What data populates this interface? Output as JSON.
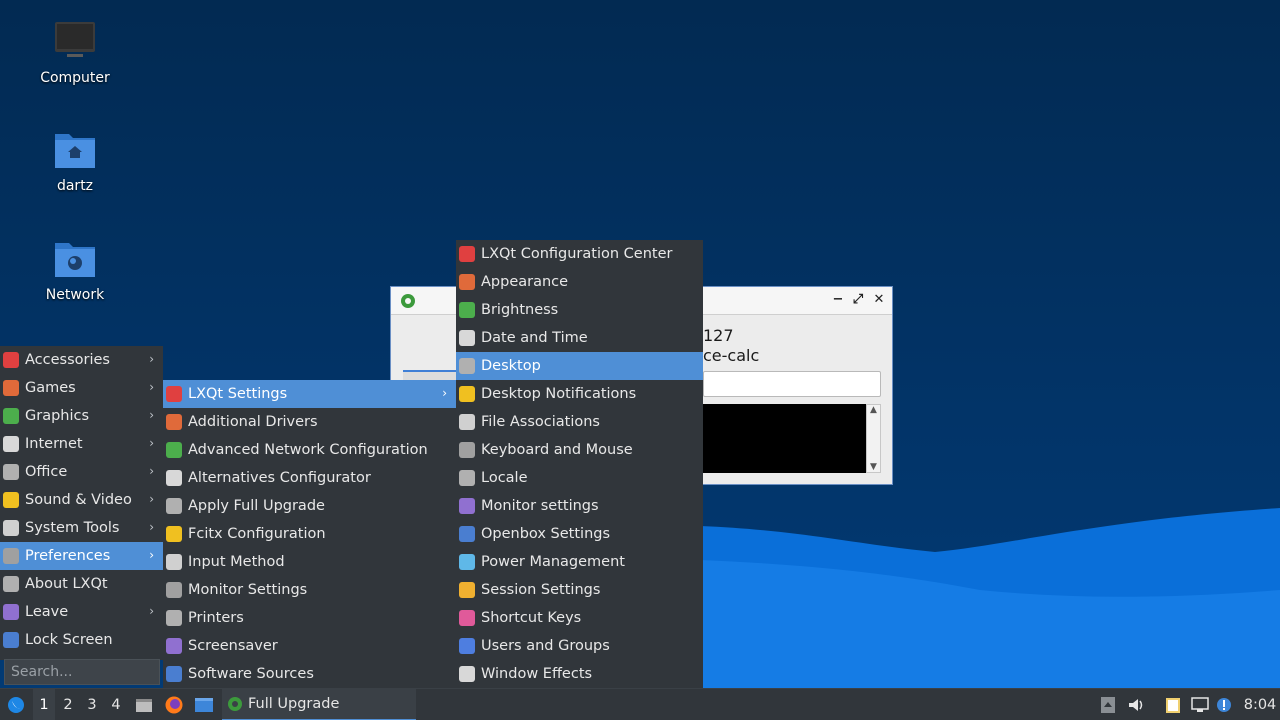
{
  "desktop": {
    "icons": [
      {
        "label": "Computer"
      },
      {
        "label": "dartz"
      },
      {
        "label": "Network"
      }
    ]
  },
  "dialog": {
    "line1": "127",
    "line2": "ce-calc",
    "controls": {
      "minimize": "−",
      "maximize": "⤢",
      "close": "✕"
    }
  },
  "main_menu": {
    "items": [
      {
        "label": "Accessories",
        "submenu": true
      },
      {
        "label": "Games",
        "submenu": true
      },
      {
        "label": "Graphics",
        "submenu": true
      },
      {
        "label": "Internet",
        "submenu": true
      },
      {
        "label": "Office",
        "submenu": true
      },
      {
        "label": "Sound & Video",
        "submenu": true
      },
      {
        "label": "System Tools",
        "submenu": true
      },
      {
        "label": "Preferences",
        "submenu": true,
        "selected": true
      },
      {
        "label": "About LXQt",
        "submenu": false
      },
      {
        "label": "Leave",
        "submenu": true
      },
      {
        "label": "Lock Screen",
        "submenu": false
      }
    ],
    "search_placeholder": "Search..."
  },
  "preferences_menu": {
    "items": [
      {
        "label": "LXQt Settings",
        "submenu": true,
        "selected": true
      },
      {
        "label": "Additional Drivers"
      },
      {
        "label": "Advanced Network Configuration"
      },
      {
        "label": "Alternatives Configurator"
      },
      {
        "label": "Apply Full Upgrade"
      },
      {
        "label": "Fcitx Configuration"
      },
      {
        "label": "Input Method"
      },
      {
        "label": "Monitor Settings"
      },
      {
        "label": "Printers"
      },
      {
        "label": "Screensaver"
      },
      {
        "label": "Software Sources"
      }
    ]
  },
  "lxqt_settings_menu": {
    "items": [
      {
        "label": "LXQt Configuration Center"
      },
      {
        "label": "Appearance"
      },
      {
        "label": "Brightness"
      },
      {
        "label": "Date and Time"
      },
      {
        "label": "Desktop",
        "selected": true
      },
      {
        "label": "Desktop Notifications"
      },
      {
        "label": "File Associations"
      },
      {
        "label": "Keyboard and Mouse"
      },
      {
        "label": "Locale"
      },
      {
        "label": "Monitor settings"
      },
      {
        "label": "Openbox Settings"
      },
      {
        "label": "Power Management"
      },
      {
        "label": "Session Settings"
      },
      {
        "label": "Shortcut Keys"
      },
      {
        "label": "Users and Groups"
      },
      {
        "label": "Window Effects"
      }
    ]
  },
  "taskbar": {
    "desktops": [
      "1",
      "2",
      "3",
      "4"
    ],
    "active_desktop": "1",
    "task_label": "Full Upgrade",
    "clock": "8:04"
  },
  "colors": {
    "accent": "#4f8fd6",
    "menu_bg": "#31363b",
    "desktop_bg": "#02284f"
  }
}
